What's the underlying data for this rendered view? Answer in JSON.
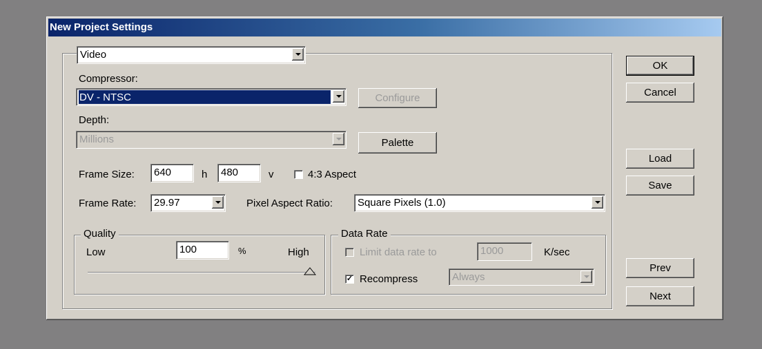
{
  "dialog": {
    "title": "New Project Settings",
    "section_select": "Video",
    "compressor": {
      "label": "Compressor:",
      "value": "DV - NTSC",
      "configure_label": "Configure"
    },
    "depth": {
      "label": "Depth:",
      "value": "Millions",
      "palette_label": "Palette"
    },
    "frame_size": {
      "label": "Frame Size:",
      "width": "640",
      "h_label": "h",
      "height": "480",
      "v_label": "v",
      "aspect_label": "4:3 Aspect",
      "aspect_checked": false
    },
    "frame_rate": {
      "label": "Frame Rate:",
      "value": "29.97"
    },
    "pixel_aspect": {
      "label": "Pixel Aspect Ratio:",
      "value": "Square Pixels (1.0)"
    },
    "quality": {
      "legend": "Quality",
      "low_label": "Low",
      "value": "100",
      "percent": "%",
      "high_label": "High",
      "level_percent": 100
    },
    "data_rate": {
      "legend": "Data Rate",
      "limit_label": "Limit data rate to",
      "limit_value": "1000",
      "unit": "K/sec",
      "limit_checked": false,
      "recompress_label": "Recompress",
      "recompress_checked": true,
      "recompress_value": "Always"
    },
    "buttons": {
      "ok": "OK",
      "cancel": "Cancel",
      "load": "Load",
      "save": "Save",
      "prev": "Prev",
      "next": "Next"
    }
  },
  "colors": {
    "desktop": "#818081",
    "face": "#d4d0c8",
    "title_start": "#0a246a",
    "title_end": "#a6caf0",
    "selection": "#0a246a"
  }
}
